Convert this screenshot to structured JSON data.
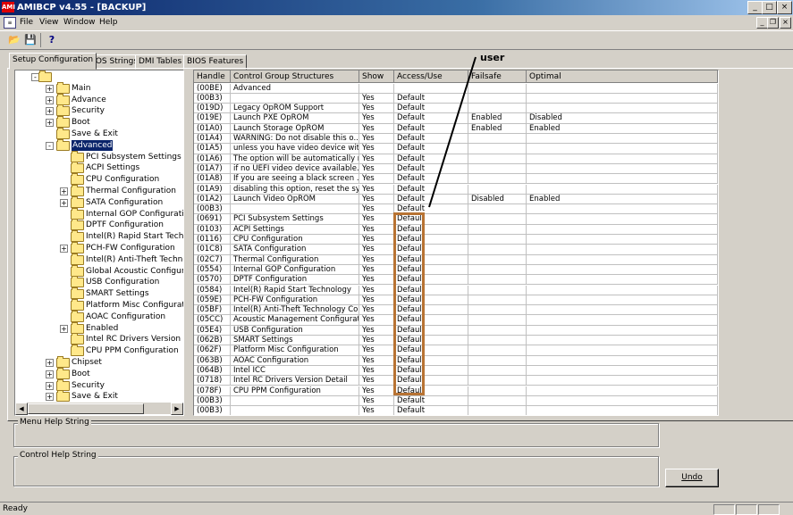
{
  "window": {
    "app_icon_text": "AMI",
    "title": "AMIBCP v4.55 - [BACKUP]"
  },
  "menubar": {
    "items": [
      "File",
      "View",
      "Window",
      "Help"
    ]
  },
  "tabs": [
    "Setup Configuration",
    "BIOS Strings",
    "DMI Tables",
    "BIOS Features"
  ],
  "tree": [
    {
      "label": "",
      "level": 0,
      "exp": "-"
    },
    {
      "label": "Main",
      "level": 1,
      "exp": "+"
    },
    {
      "label": "Advance",
      "level": 1,
      "exp": "+"
    },
    {
      "label": "Security",
      "level": 1,
      "exp": "+"
    },
    {
      "label": "Boot",
      "level": 1,
      "exp": "+"
    },
    {
      "label": "Save & Exit",
      "level": 1,
      "exp": ""
    },
    {
      "label": "Advanced",
      "level": 1,
      "exp": "-",
      "selected": true
    },
    {
      "label": "PCI Subsystem Settings",
      "level": 2,
      "exp": ""
    },
    {
      "label": "ACPI Settings",
      "level": 2,
      "exp": ""
    },
    {
      "label": "CPU Configuration",
      "level": 2,
      "exp": ""
    },
    {
      "label": "Thermal Configuration",
      "level": 2,
      "exp": "+"
    },
    {
      "label": "SATA Configuration",
      "level": 2,
      "exp": "+"
    },
    {
      "label": "Internal GOP Configuration",
      "level": 2,
      "exp": ""
    },
    {
      "label": "DPTF Configuration",
      "level": 2,
      "exp": ""
    },
    {
      "label": "Intel(R) Rapid Start Technology",
      "level": 2,
      "exp": ""
    },
    {
      "label": "PCH-FW Configuration",
      "level": 2,
      "exp": "+"
    },
    {
      "label": "Intel(R) Anti-Theft Technology Co",
      "level": 2,
      "exp": ""
    },
    {
      "label": "Global Acoustic Configuration",
      "level": 2,
      "exp": ""
    },
    {
      "label": "USB Configuration",
      "level": 2,
      "exp": ""
    },
    {
      "label": "SMART Settings",
      "level": 2,
      "exp": ""
    },
    {
      "label": "Platform Misc Configuration",
      "level": 2,
      "exp": ""
    },
    {
      "label": "AOAC Configuration",
      "level": 2,
      "exp": ""
    },
    {
      "label": "Enabled",
      "level": 2,
      "exp": "+"
    },
    {
      "label": "Intel RC Drivers Version Detail",
      "level": 2,
      "exp": ""
    },
    {
      "label": "CPU PPM Configuration",
      "level": 2,
      "exp": ""
    },
    {
      "label": "Chipset",
      "level": 1,
      "exp": "+"
    },
    {
      "label": "Boot",
      "level": 1,
      "exp": "+"
    },
    {
      "label": "Security",
      "level": 1,
      "exp": "+"
    },
    {
      "label": "Save & Exit",
      "level": 1,
      "exp": "+"
    }
  ],
  "grid": {
    "columns": [
      "Handle",
      "Control Group Structures",
      "Show",
      "Access/Use",
      "Failsafe",
      "Optimal"
    ],
    "rows": [
      [
        "(00BE)",
        "Advanced",
        "",
        "",
        "",
        ""
      ],
      [
        "(00B3)",
        "",
        "Yes",
        "Default",
        "",
        ""
      ],
      [
        "(019D)",
        "Legacy OpROM Support",
        "Yes",
        "Default",
        "",
        ""
      ],
      [
        "(019E)",
        "Launch PXE OpROM",
        "Yes",
        "Default",
        "Enabled",
        "Disabled"
      ],
      [
        "(01A0)",
        "Launch Storage OpROM",
        "Yes",
        "Default",
        "Enabled",
        "Enabled"
      ],
      [
        "(01A4)",
        "WARNING: Do not disable this o...",
        "Yes",
        "Default",
        "",
        ""
      ],
      [
        "(01A5)",
        "unless you have video device wit...",
        "Yes",
        "Default",
        "",
        ""
      ],
      [
        "(01A6)",
        "The option will be automatically re...",
        "Yes",
        "Default",
        "",
        ""
      ],
      [
        "(01A7)",
        "if no UEFI video device available.",
        "Yes",
        "Default",
        "",
        ""
      ],
      [
        "(01A8)",
        "If you are seeing a black screen ...",
        "Yes",
        "Default",
        "",
        ""
      ],
      [
        "(01A9)",
        "disabling this option, reset the sys...",
        "Yes",
        "Default",
        "",
        ""
      ],
      [
        "(01A2)",
        "Launch Video OpROM",
        "Yes",
        "Default",
        "Disabled",
        "Enabled"
      ],
      [
        "(00B3)",
        "",
        "Yes",
        "Default",
        "",
        ""
      ],
      [
        "(0691)",
        "PCI Subsystem Settings",
        "Yes",
        "Default",
        "",
        ""
      ],
      [
        "(0103)",
        "ACPI Settings",
        "Yes",
        "Default",
        "",
        ""
      ],
      [
        "(0116)",
        "CPU Configuration",
        "Yes",
        "Default",
        "",
        ""
      ],
      [
        "(01C8)",
        "SATA Configuration",
        "Yes",
        "Default",
        "",
        ""
      ],
      [
        "(02C7)",
        "Thermal Configuration",
        "Yes",
        "Default",
        "",
        ""
      ],
      [
        "(0554)",
        "Internal GOP Configuration",
        "Yes",
        "Default",
        "",
        ""
      ],
      [
        "(0570)",
        "DPTF Configuration",
        "Yes",
        "Default",
        "",
        ""
      ],
      [
        "(0584)",
        "Intel(R) Rapid Start Technology",
        "Yes",
        "Default",
        "",
        ""
      ],
      [
        "(059E)",
        "PCH-FW Configuration",
        "Yes",
        "Default",
        "",
        ""
      ],
      [
        "(05BF)",
        "Intel(R) Anti-Theft Technology Co...",
        "Yes",
        "Default",
        "",
        ""
      ],
      [
        "(05CC)",
        "Acoustic Management Configurati...",
        "Yes",
        "Default",
        "",
        ""
      ],
      [
        "(05E4)",
        "USB Configuration",
        "Yes",
        "Default",
        "",
        ""
      ],
      [
        "(062B)",
        "SMART Settings",
        "Yes",
        "Default",
        "",
        ""
      ],
      [
        "(062F)",
        "Platform Misc Configuration",
        "Yes",
        "Default",
        "",
        ""
      ],
      [
        "(063B)",
        "AOAC Configuration",
        "Yes",
        "Default",
        "",
        ""
      ],
      [
        "(064B)",
        "Intel ICC",
        "Yes",
        "Default",
        "",
        ""
      ],
      [
        "(0718)",
        "Intel RC Drivers Version Detail",
        "Yes",
        "Default",
        "",
        ""
      ],
      [
        "(078F)",
        "CPU PPM Configuration",
        "Yes",
        "Default",
        "",
        ""
      ],
      [
        "(00B3)",
        "",
        "Yes",
        "Default",
        "",
        ""
      ],
      [
        "(00B3)",
        "",
        "Yes",
        "Default",
        "",
        ""
      ]
    ]
  },
  "annotation": {
    "label": "user",
    "color": "#b87333"
  },
  "help": {
    "menu_title": "Menu Help String",
    "control_title": "Control Help String"
  },
  "buttons": {
    "undo": "Undo"
  },
  "status": {
    "text": "Ready"
  }
}
